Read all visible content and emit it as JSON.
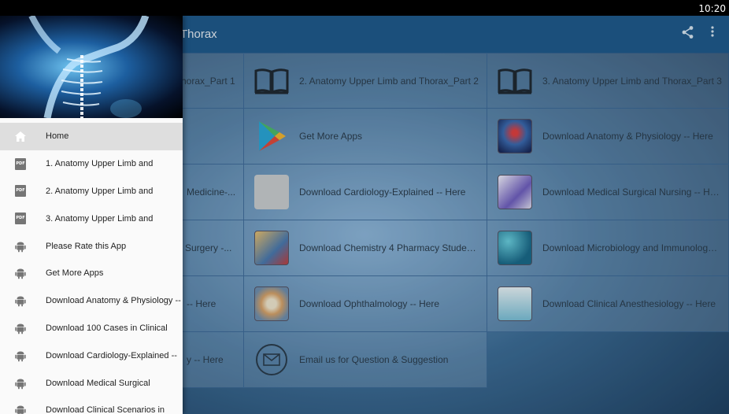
{
  "status_bar": {
    "time": "10:20"
  },
  "toolbar": {
    "title": "Thorax",
    "share_icon": "share-icon",
    "overflow_icon": "overflow-menu-icon"
  },
  "grid": {
    "row0": [
      {
        "label": "horax_Part 1",
        "icon": "book-icon"
      },
      {
        "label": "2.  Anatomy Upper Limb and Thorax_Part 2",
        "icon": "book-icon"
      },
      {
        "label": "3.  Anatomy Upper Limb and Thorax_Part 3",
        "icon": "book-icon"
      }
    ],
    "row1": [
      {
        "label": "",
        "icon": ""
      },
      {
        "label": "Get More Apps",
        "icon": "play-store-icon"
      },
      {
        "label": "Download Anatomy & Physiology -- Here",
        "icon": "anatomy-thumbnail"
      }
    ],
    "row2": [
      {
        "label": "Medicine-...",
        "icon": ""
      },
      {
        "label": "Download Cardiology-Explained -- Here",
        "icon": "cardiology-thumbnail"
      },
      {
        "label": "Download Medical Surgical Nursing -- Here",
        "icon": "nursing-thumbnail"
      }
    ],
    "row3": [
      {
        "label": "Surgery -...",
        "icon": ""
      },
      {
        "label": "Download Chemistry 4 Pharmacy Student...",
        "icon": "chemistry-thumbnail"
      },
      {
        "label": "Download Microbiology and Immunology-...",
        "icon": "microbiology-thumbnail"
      }
    ],
    "row4": [
      {
        "label": "-- Here",
        "icon": ""
      },
      {
        "label": "Download Ophthalmology -- Here",
        "icon": "ophthalmology-thumbnail"
      },
      {
        "label": "Download Clinical Anesthesiology -- Here",
        "icon": "anesthesiology-thumbnail"
      }
    ],
    "row5": [
      {
        "label": "y -- Here",
        "icon": ""
      },
      {
        "label": "Email us for Question & Suggestion",
        "icon": "email-icon"
      }
    ]
  },
  "drawer": {
    "items": [
      {
        "label": "Home",
        "icon": "home-icon"
      },
      {
        "label": "1.  Anatomy Upper Limb and",
        "icon": "pdf-icon"
      },
      {
        "label": "2.  Anatomy Upper Limb and",
        "icon": "pdf-icon"
      },
      {
        "label": "3.  Anatomy Upper Limb and",
        "icon": "pdf-icon"
      },
      {
        "label": "Please Rate this App",
        "icon": "android-icon"
      },
      {
        "label": "Get More Apps",
        "icon": "android-icon"
      },
      {
        "label": "Download Anatomy & Physiology --",
        "icon": "android-icon"
      },
      {
        "label": "Download 100 Cases in Clinical",
        "icon": "android-icon"
      },
      {
        "label": "Download Cardiology-Explained --",
        "icon": "android-icon"
      },
      {
        "label": "Download Medical Surgical",
        "icon": "android-icon"
      },
      {
        "label": "Download Clinical Scenarios in",
        "icon": "android-icon"
      }
    ],
    "pdf_text": "PDF"
  },
  "colors": {
    "toolbar": "#1f5a8c",
    "drawer_bg": "#fafafa",
    "drawer_active": "#dedede",
    "icon_grey": "#757575"
  }
}
